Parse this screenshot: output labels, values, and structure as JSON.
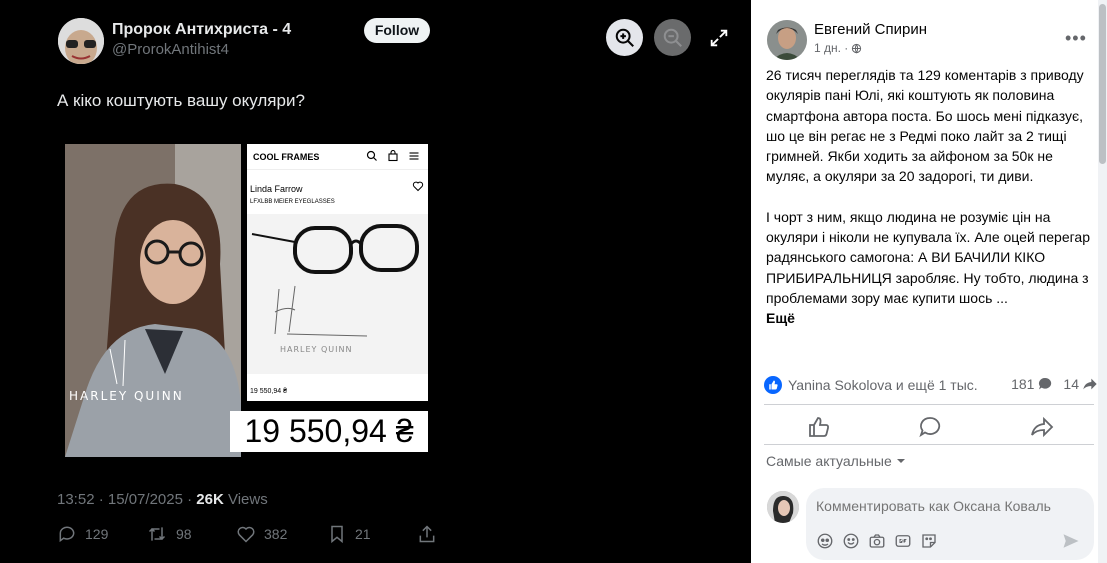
{
  "tweet": {
    "author_name": "Пророк Антихриста - 4",
    "author_handle": "@ProrokAntihist4",
    "follow_label": "Follow",
    "text": "А кіко коштують вашу окуляри?",
    "media": {
      "photo_caption": "HARLEY QUINN",
      "shop_logo": "COOL FRAMES",
      "brand": "Linda Farrow",
      "model": "LFXLBB MEIER EYEGLASSES",
      "image_caption": "HARLEY QUINN",
      "small_price": "19 550,94 ₴",
      "big_price": "19 550,94 ₴"
    },
    "timestamp": "13:52 · 15/07/2025 · ",
    "views_count": "26K",
    "views_label": " Views",
    "actions": {
      "replies": "129",
      "reposts": "98",
      "likes": "382",
      "bookmarks": "21"
    }
  },
  "viewer": {
    "zoom_in": "zoom-in-icon",
    "zoom_out": "zoom-out-icon",
    "expand": "expand-icon"
  },
  "post": {
    "author": "Евгений Спирин",
    "time": "1 дн. ·",
    "paragraph1": "26 тисяч переглядів та 129 коментарів з приводу окулярів пані Юлі, які коштують як половина смартфона автора поста. Бо шось мені підказує, шо це він регає не з Редмі поко лайт за 2 тищі гримней. Якби ходить за айфоном за 50к не муляє, а окуляри за 20 задорогі, ти диви.",
    "paragraph2": "І чорт з ним, якщо людина не розуміє цін на окуляри і ніколи не купувала їх. Але оцей перегар радянського самогона: А ВИ БАЧИЛИ КІКО ПРИБИРАЛЬНИЦЯ заробляє. Ну тобто, людина з проблемами зору має купити шось ...",
    "see_more": "Ещё",
    "likers": "Yanina Sokolova и ещё 1 тыс.",
    "comments_count": "181",
    "shares_count": "14",
    "sort_label": "Самые актуальные",
    "comment_placeholder": "Комментировать как Оксана Коваль"
  },
  "colors": {
    "like_blue": "#0866ff",
    "dark_bg": "#000000",
    "muted": "#65676b"
  }
}
